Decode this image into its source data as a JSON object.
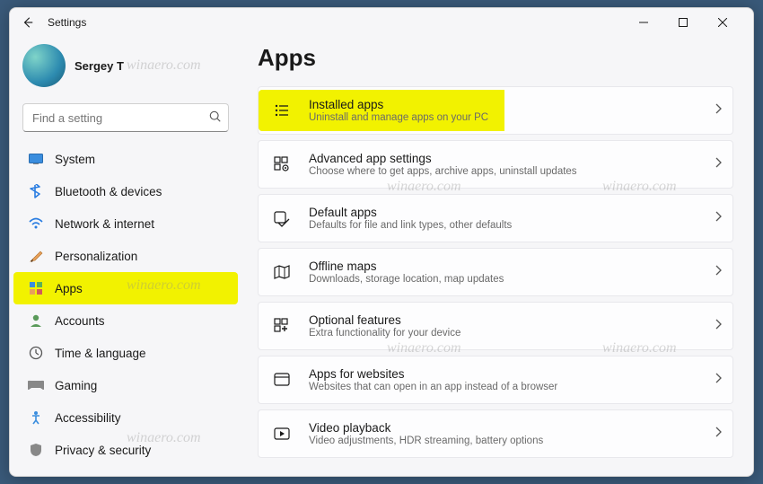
{
  "window": {
    "title": "Settings"
  },
  "profile": {
    "name": "Sergey T"
  },
  "search": {
    "placeholder": "Find a setting"
  },
  "sidebar": {
    "items": [
      {
        "label": "System"
      },
      {
        "label": "Bluetooth & devices"
      },
      {
        "label": "Network & internet"
      },
      {
        "label": "Personalization"
      },
      {
        "label": "Apps"
      },
      {
        "label": "Accounts"
      },
      {
        "label": "Time & language"
      },
      {
        "label": "Gaming"
      },
      {
        "label": "Accessibility"
      },
      {
        "label": "Privacy & security"
      }
    ]
  },
  "page": {
    "title": "Apps"
  },
  "cards": [
    {
      "title": "Installed apps",
      "sub": "Uninstall and manage apps on your PC"
    },
    {
      "title": "Advanced app settings",
      "sub": "Choose where to get apps, archive apps, uninstall updates"
    },
    {
      "title": "Default apps",
      "sub": "Defaults for file and link types, other defaults"
    },
    {
      "title": "Offline maps",
      "sub": "Downloads, storage location, map updates"
    },
    {
      "title": "Optional features",
      "sub": "Extra functionality for your device"
    },
    {
      "title": "Apps for websites",
      "sub": "Websites that can open in an app instead of a browser"
    },
    {
      "title": "Video playback",
      "sub": "Video adjustments, HDR streaming, battery options"
    }
  ],
  "watermark": "winaero.com"
}
